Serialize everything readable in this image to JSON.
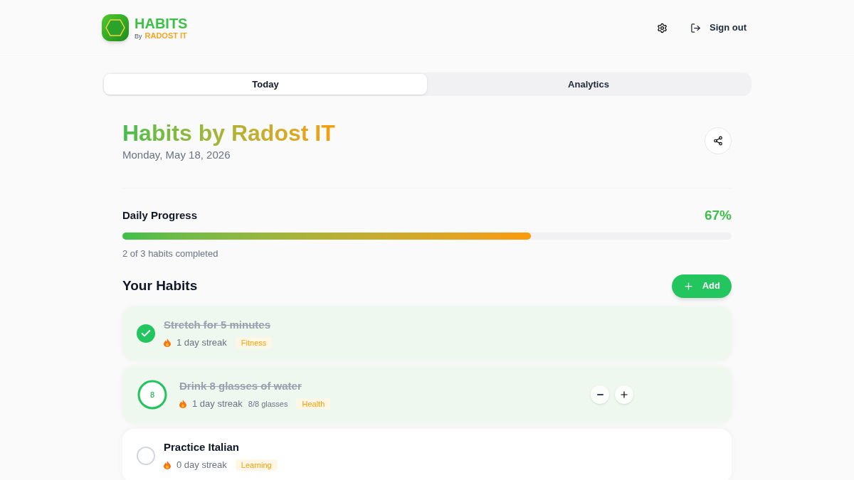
{
  "brand": {
    "name": "HABITS",
    "by": "By",
    "company": "RADOST IT"
  },
  "header": {
    "sign_out": "Sign out"
  },
  "tabs": [
    {
      "label": "Today",
      "selected": true
    },
    {
      "label": "Analytics",
      "selected": false
    }
  ],
  "title": "Habits by Radost IT",
  "date": "Monday, May 18, 2026",
  "progress": {
    "label": "Daily Progress",
    "percent": "67%",
    "level": 0.67,
    "caption": "2 of 3 habits completed"
  },
  "habits_section": {
    "title": "Your Habits",
    "add": "Add"
  },
  "habits": [
    {
      "kind": "check",
      "name": "Stretch for 5 minutes",
      "done": true,
      "streak": "1 day streak",
      "tag": "Fitness"
    },
    {
      "kind": "counter",
      "name": "Drink 8 glasses of water",
      "done": true,
      "count": "8",
      "level": 1,
      "streak": "1 day streak",
      "amount": "8/8 glasses",
      "tag": "Health"
    },
    {
      "kind": "check",
      "name": "Practice Italian",
      "done": false,
      "streak": "0 day streak",
      "tag": "Learning"
    }
  ]
}
